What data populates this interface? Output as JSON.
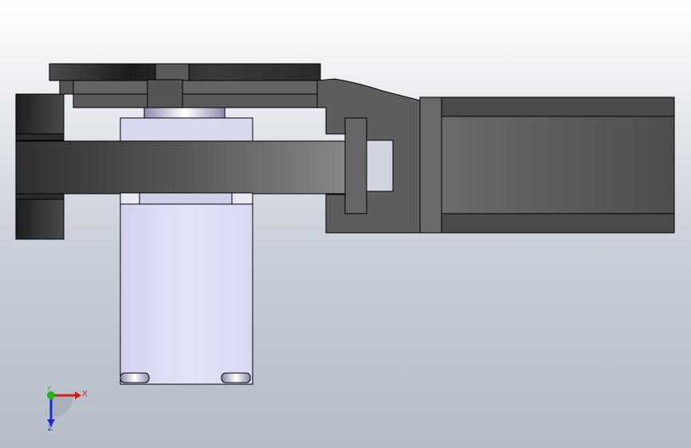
{
  "viewport": {
    "background_top": "#ffffff",
    "background_bottom": "#b4bcc7"
  },
  "model": {
    "dark_part_color": "#3c3c3c",
    "mid_part_color": "#6a6a6a",
    "light_part_color": "#dcdcf2",
    "edge_color": "#000000"
  },
  "triad": {
    "x_label": "X",
    "y_label": "Y",
    "z_label": "Z",
    "x_color": "#d01c1c",
    "y_color": "#1cb51c",
    "z_color": "#1c28d0"
  }
}
